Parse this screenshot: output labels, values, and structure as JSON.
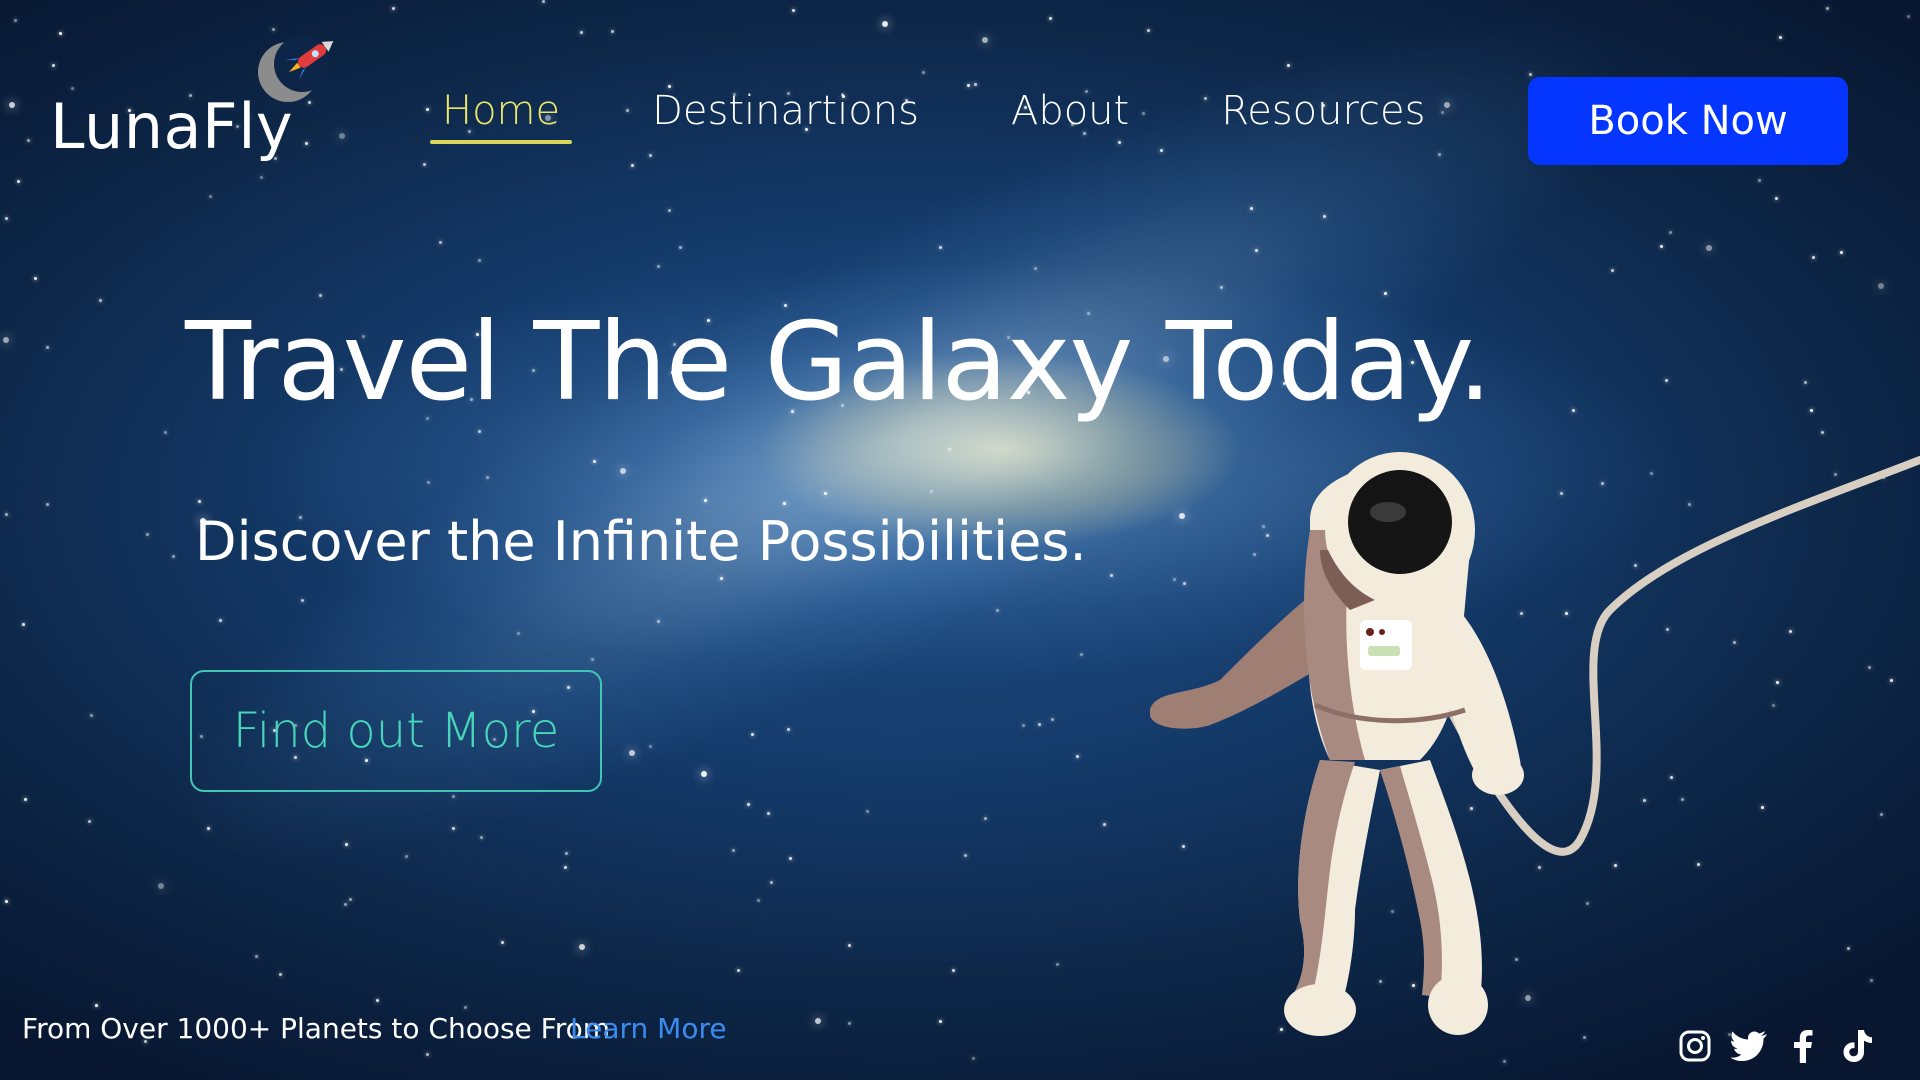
{
  "brand": {
    "name": "LunaFly",
    "logo_icon": "moon-rocket-icon"
  },
  "nav": {
    "items": [
      {
        "label": "Home",
        "active": true
      },
      {
        "label": "Destinartions",
        "active": false
      },
      {
        "label": "About",
        "active": false
      },
      {
        "label": "Resources",
        "active": false
      }
    ],
    "active_color": "#e9e66b"
  },
  "book_button": {
    "label": "Book Now",
    "color": "#0536ff"
  },
  "hero": {
    "title": "Travel The Galaxy Today.",
    "subtitle": "Discover the Infinite Possibilities.",
    "cta_label": "Find out More",
    "cta_color": "#47d6b9"
  },
  "footer": {
    "note": "From Over 1000+ Planets to Choose From",
    "learn_more": "Learn More",
    "link_color": "#3a8cf0"
  },
  "socials": [
    "instagram-icon",
    "twitter-icon",
    "facebook-icon",
    "tiktok-icon"
  ]
}
